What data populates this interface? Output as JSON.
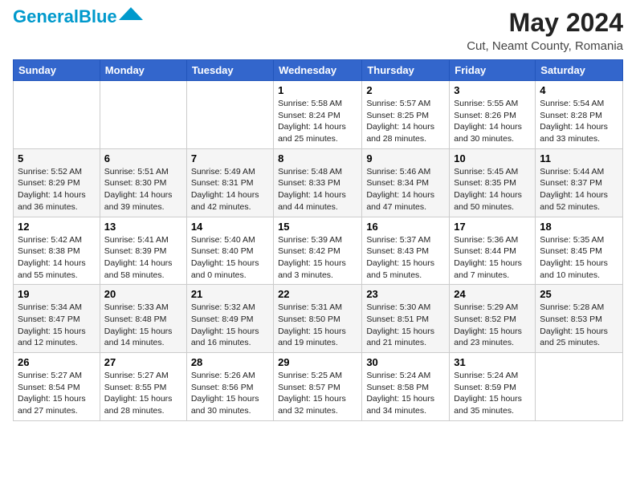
{
  "header": {
    "logo_general": "General",
    "logo_blue": "Blue",
    "title": "May 2024",
    "subtitle": "Cut, Neamt County, Romania"
  },
  "days_of_week": [
    "Sunday",
    "Monday",
    "Tuesday",
    "Wednesday",
    "Thursday",
    "Friday",
    "Saturday"
  ],
  "weeks": [
    [
      {
        "day": "",
        "info": ""
      },
      {
        "day": "",
        "info": ""
      },
      {
        "day": "",
        "info": ""
      },
      {
        "day": "1",
        "info": "Sunrise: 5:58 AM\nSunset: 8:24 PM\nDaylight: 14 hours and 25 minutes."
      },
      {
        "day": "2",
        "info": "Sunrise: 5:57 AM\nSunset: 8:25 PM\nDaylight: 14 hours and 28 minutes."
      },
      {
        "day": "3",
        "info": "Sunrise: 5:55 AM\nSunset: 8:26 PM\nDaylight: 14 hours and 30 minutes."
      },
      {
        "day": "4",
        "info": "Sunrise: 5:54 AM\nSunset: 8:28 PM\nDaylight: 14 hours and 33 minutes."
      }
    ],
    [
      {
        "day": "5",
        "info": "Sunrise: 5:52 AM\nSunset: 8:29 PM\nDaylight: 14 hours and 36 minutes."
      },
      {
        "day": "6",
        "info": "Sunrise: 5:51 AM\nSunset: 8:30 PM\nDaylight: 14 hours and 39 minutes."
      },
      {
        "day": "7",
        "info": "Sunrise: 5:49 AM\nSunset: 8:31 PM\nDaylight: 14 hours and 42 minutes."
      },
      {
        "day": "8",
        "info": "Sunrise: 5:48 AM\nSunset: 8:33 PM\nDaylight: 14 hours and 44 minutes."
      },
      {
        "day": "9",
        "info": "Sunrise: 5:46 AM\nSunset: 8:34 PM\nDaylight: 14 hours and 47 minutes."
      },
      {
        "day": "10",
        "info": "Sunrise: 5:45 AM\nSunset: 8:35 PM\nDaylight: 14 hours and 50 minutes."
      },
      {
        "day": "11",
        "info": "Sunrise: 5:44 AM\nSunset: 8:37 PM\nDaylight: 14 hours and 52 minutes."
      }
    ],
    [
      {
        "day": "12",
        "info": "Sunrise: 5:42 AM\nSunset: 8:38 PM\nDaylight: 14 hours and 55 minutes."
      },
      {
        "day": "13",
        "info": "Sunrise: 5:41 AM\nSunset: 8:39 PM\nDaylight: 14 hours and 58 minutes."
      },
      {
        "day": "14",
        "info": "Sunrise: 5:40 AM\nSunset: 8:40 PM\nDaylight: 15 hours and 0 minutes."
      },
      {
        "day": "15",
        "info": "Sunrise: 5:39 AM\nSunset: 8:42 PM\nDaylight: 15 hours and 3 minutes."
      },
      {
        "day": "16",
        "info": "Sunrise: 5:37 AM\nSunset: 8:43 PM\nDaylight: 15 hours and 5 minutes."
      },
      {
        "day": "17",
        "info": "Sunrise: 5:36 AM\nSunset: 8:44 PM\nDaylight: 15 hours and 7 minutes."
      },
      {
        "day": "18",
        "info": "Sunrise: 5:35 AM\nSunset: 8:45 PM\nDaylight: 15 hours and 10 minutes."
      }
    ],
    [
      {
        "day": "19",
        "info": "Sunrise: 5:34 AM\nSunset: 8:47 PM\nDaylight: 15 hours and 12 minutes."
      },
      {
        "day": "20",
        "info": "Sunrise: 5:33 AM\nSunset: 8:48 PM\nDaylight: 15 hours and 14 minutes."
      },
      {
        "day": "21",
        "info": "Sunrise: 5:32 AM\nSunset: 8:49 PM\nDaylight: 15 hours and 16 minutes."
      },
      {
        "day": "22",
        "info": "Sunrise: 5:31 AM\nSunset: 8:50 PM\nDaylight: 15 hours and 19 minutes."
      },
      {
        "day": "23",
        "info": "Sunrise: 5:30 AM\nSunset: 8:51 PM\nDaylight: 15 hours and 21 minutes."
      },
      {
        "day": "24",
        "info": "Sunrise: 5:29 AM\nSunset: 8:52 PM\nDaylight: 15 hours and 23 minutes."
      },
      {
        "day": "25",
        "info": "Sunrise: 5:28 AM\nSunset: 8:53 PM\nDaylight: 15 hours and 25 minutes."
      }
    ],
    [
      {
        "day": "26",
        "info": "Sunrise: 5:27 AM\nSunset: 8:54 PM\nDaylight: 15 hours and 27 minutes."
      },
      {
        "day": "27",
        "info": "Sunrise: 5:27 AM\nSunset: 8:55 PM\nDaylight: 15 hours and 28 minutes."
      },
      {
        "day": "28",
        "info": "Sunrise: 5:26 AM\nSunset: 8:56 PM\nDaylight: 15 hours and 30 minutes."
      },
      {
        "day": "29",
        "info": "Sunrise: 5:25 AM\nSunset: 8:57 PM\nDaylight: 15 hours and 32 minutes."
      },
      {
        "day": "30",
        "info": "Sunrise: 5:24 AM\nSunset: 8:58 PM\nDaylight: 15 hours and 34 minutes."
      },
      {
        "day": "31",
        "info": "Sunrise: 5:24 AM\nSunset: 8:59 PM\nDaylight: 15 hours and 35 minutes."
      },
      {
        "day": "",
        "info": ""
      }
    ]
  ]
}
